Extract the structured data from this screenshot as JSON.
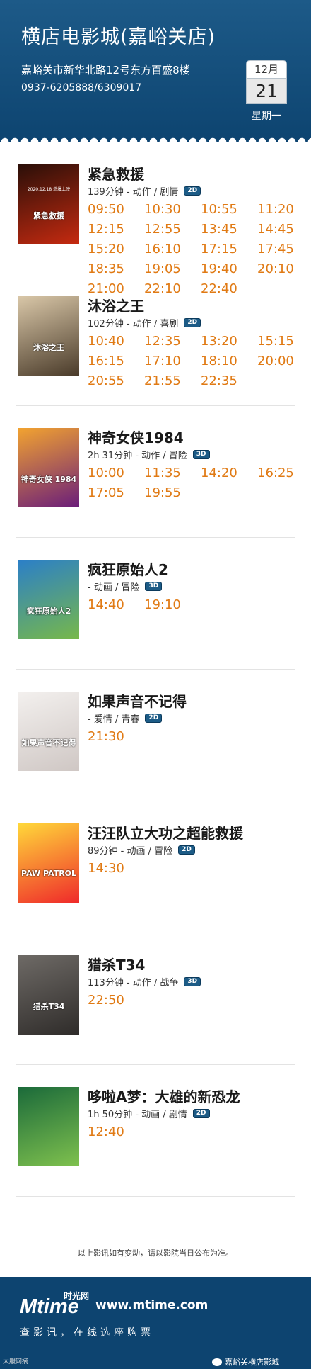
{
  "header": {
    "title": "横店电影城(嘉峪关店)",
    "address": "嘉峪关市新华北路12号东方百盛8楼",
    "phone": "0937-6205888/6309017",
    "calendar": {
      "month": "12月",
      "day": "21",
      "weekday": "星期一"
    }
  },
  "colors": {
    "header_bg": "#0d4470",
    "time_color": "#e07a14",
    "badge_bg": "#1c5b86"
  },
  "movies": [
    {
      "title": "紧急救援",
      "info": "139分钟 - 动作 / 剧情",
      "format": "2D",
      "times": [
        "09:50",
        "10:30",
        "10:55",
        "11:20",
        "12:15",
        "12:55",
        "13:45",
        "14:45",
        "15:20",
        "16:10",
        "17:15",
        "17:45",
        "18:35",
        "19:05",
        "19:40",
        "20:10",
        "21:00",
        "22:10",
        "22:40"
      ]
    },
    {
      "title": "沐浴之王",
      "info": "102分钟 - 动作 / 喜剧",
      "format": "2D",
      "times": [
        "10:40",
        "12:35",
        "13:20",
        "15:15",
        "16:15",
        "17:10",
        "18:10",
        "20:00",
        "20:55",
        "21:55",
        "22:35"
      ]
    },
    {
      "title": "神奇女侠1984",
      "info": "2h 31分钟 - 动作 / 冒险",
      "format": "3D",
      "times": [
        "10:00",
        "11:35",
        "14:20",
        "16:25",
        "17:05",
        "19:55"
      ]
    },
    {
      "title": "疯狂原始人2",
      "info": "- 动画 / 冒险",
      "format": "3D",
      "times": [
        "14:40",
        "19:10"
      ]
    },
    {
      "title": "如果声音不记得",
      "info": "- 爱情 / 青春",
      "format": "2D",
      "times": [
        "21:30"
      ]
    },
    {
      "title": "汪汪队立大功之超能救援",
      "info": "89分钟 - 动画 / 冒险",
      "format": "2D",
      "times": [
        "14:30"
      ]
    },
    {
      "title": "猎杀T34",
      "info": "113分钟 - 动作 / 战争",
      "format": "3D",
      "times": [
        "22:50"
      ]
    },
    {
      "title": "哆啦A梦：大雄的新恐龙",
      "info": "1h 50分钟 - 动画 / 剧情",
      "format": "2D",
      "times": [
        "12:40"
      ]
    }
  ],
  "posters": [
    {
      "text": "紧急救援",
      "date": "2020.12.18 燃爆上映",
      "colors": [
        "#2a0f08",
        "#c52a10"
      ]
    },
    {
      "text": "沐浴之王",
      "date": "",
      "colors": [
        "#d9c7a8",
        "#4a3b2a"
      ]
    },
    {
      "text": "神奇女侠 1984",
      "date": "",
      "colors": [
        "#f2a330",
        "#6a1d7a"
      ]
    },
    {
      "text": "疯狂原始人2",
      "date": "",
      "colors": [
        "#2b7fc8",
        "#77b84a"
      ]
    },
    {
      "text": "如果声音不记得",
      "date": "",
      "colors": [
        "#f3f0ee",
        "#cfc7c4"
      ]
    },
    {
      "text": "PAW PATROL",
      "date": "",
      "colors": [
        "#ffd83a",
        "#ef2a2a"
      ]
    },
    {
      "text": "猎杀T34",
      "date": "",
      "colors": [
        "#6e6a66",
        "#2f2c2a"
      ]
    },
    {
      "text": "",
      "date": "",
      "colors": [
        "#1b6a3a",
        "#7fc14e"
      ]
    }
  ],
  "notice": "以上影讯如有变动，请以影院当日公布为准。",
  "footer": {
    "logo_main": "Mtime",
    "logo_cn": "时光网",
    "url": "www.mtime.com",
    "slogan": "查影讯，在线选座购票",
    "wechat": "嘉峪关横店影城",
    "watermark": "大服网摘"
  }
}
